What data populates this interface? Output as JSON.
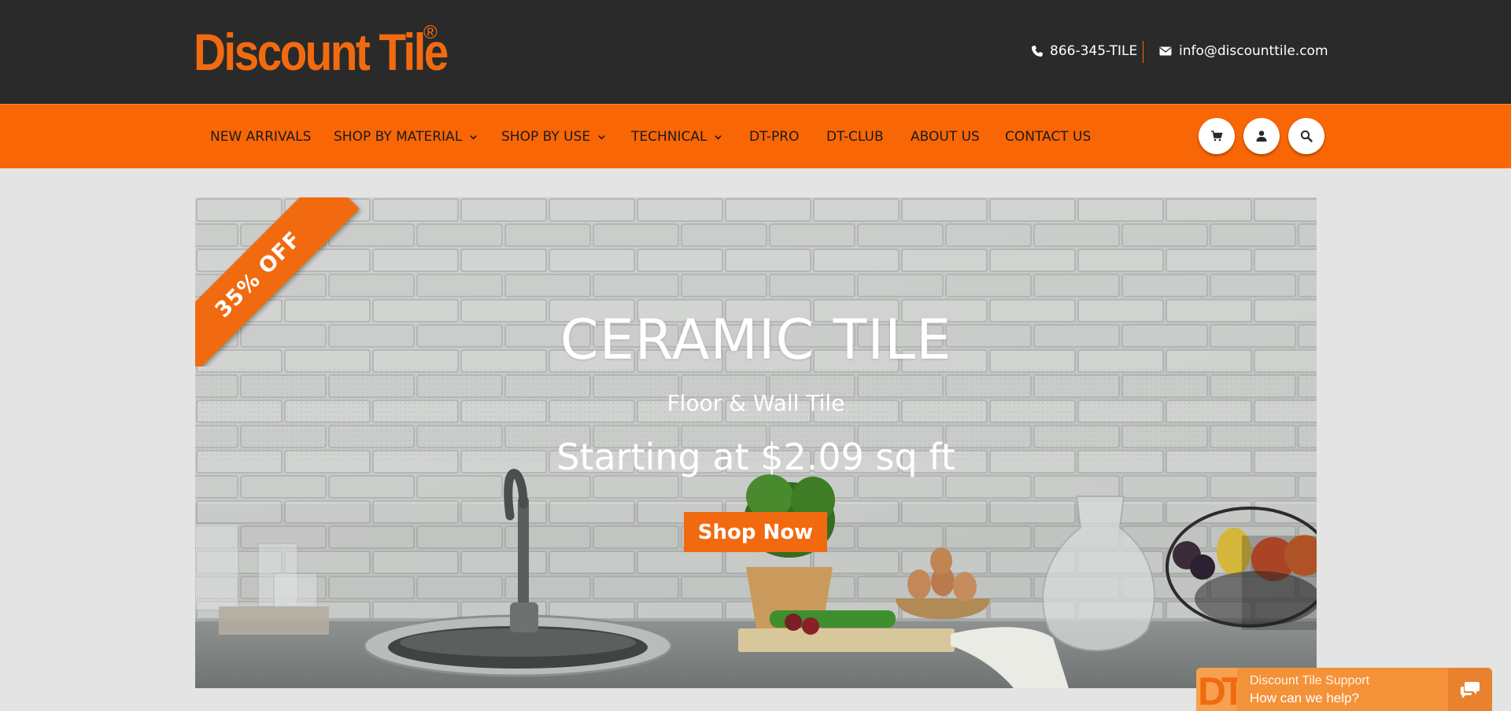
{
  "header": {
    "logo_text": "Discount Tile",
    "logo_mark": "®",
    "phone": "866-345-TILE",
    "email": "info@discounttile.com",
    "phone_icon": "phone-icon",
    "email_icon": "envelope-icon"
  },
  "nav": {
    "items": [
      {
        "label": "NEW ARRIVALS"
      },
      {
        "label": "SHOP BY MATERIAL"
      },
      {
        "label": "SHOP BY USE"
      },
      {
        "label": "TECHNICAL"
      },
      {
        "label": "DT-PRO"
      },
      {
        "label": "DT-CLUB"
      },
      {
        "label": "ABOUT US"
      },
      {
        "label": "CONTACT US"
      }
    ],
    "icons": [
      "cart-icon",
      "user-icon",
      "search-icon"
    ]
  },
  "banner": {
    "ribbon": "35% OFF",
    "title": "CERAMIC TILE",
    "subtitle": "Floor & Wall Tile",
    "price": "Starting at $2.09 sq ft",
    "cta": "Shop Now"
  },
  "chat": {
    "logo": "DT",
    "title": "Discount Tile Support",
    "subtitle": "How can we help?",
    "icon": "chat-bubbles-icon"
  },
  "colors": {
    "brand_orange": "#f96606",
    "header_dark": "#2a2a2a",
    "page_bg": "#e4e4e4",
    "chat_orange": "#f4923a"
  }
}
